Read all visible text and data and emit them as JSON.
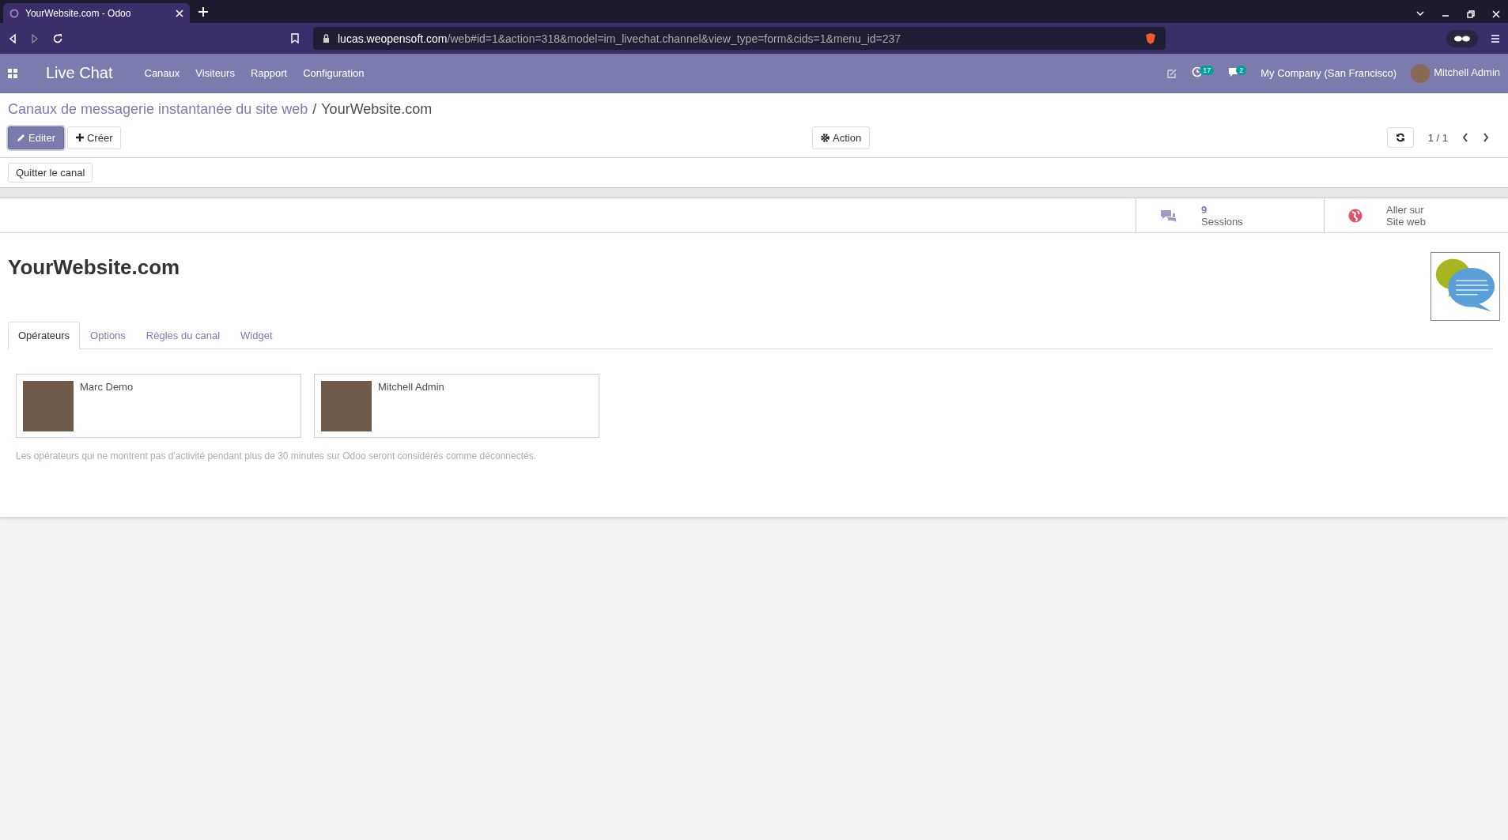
{
  "browser": {
    "tab_title": "YourWebsite.com - Odoo",
    "url_host": "lucas.weopensoft.com",
    "url_path": "/web#id=1&action=318&model=im_livechat.channel&view_type=form&cids=1&menu_id=237"
  },
  "navbar": {
    "app": "Live Chat",
    "menu": [
      "Canaux",
      "Visiteurs",
      "Rapport",
      "Configuration"
    ],
    "activity_count": "17",
    "message_count": "2",
    "company": "My Company (San Francisco)",
    "user": "Mitchell Admin"
  },
  "breadcrumb": {
    "parent": "Canaux de messagerie instantanée du site web",
    "separator": "/",
    "current": "YourWebsite.com"
  },
  "control": {
    "edit": "Editer",
    "create": "Créer",
    "action": "Action",
    "pager": "1 / 1"
  },
  "header_button": "Quitter le canal",
  "stat_buttons": [
    {
      "kind": "sessions",
      "value": "9",
      "label": "Sessions"
    },
    {
      "kind": "website",
      "line1": "Aller sur",
      "line2": "Site web"
    }
  ],
  "record": {
    "title": "YourWebsite.com"
  },
  "tabs": [
    {
      "label": "Opérateurs",
      "selected": true
    },
    {
      "label": "Options",
      "selected": false
    },
    {
      "label": "Règles du canal",
      "selected": false
    },
    {
      "label": "Widget",
      "selected": false
    }
  ],
  "operators": [
    {
      "name": "Marc Demo"
    },
    {
      "name": "Mitchell Admin"
    }
  ],
  "note": "Les opérateurs qui ne montrent pas d'activité pendant plus de 30 minutes sur Odoo seront considérés comme déconnectés."
}
